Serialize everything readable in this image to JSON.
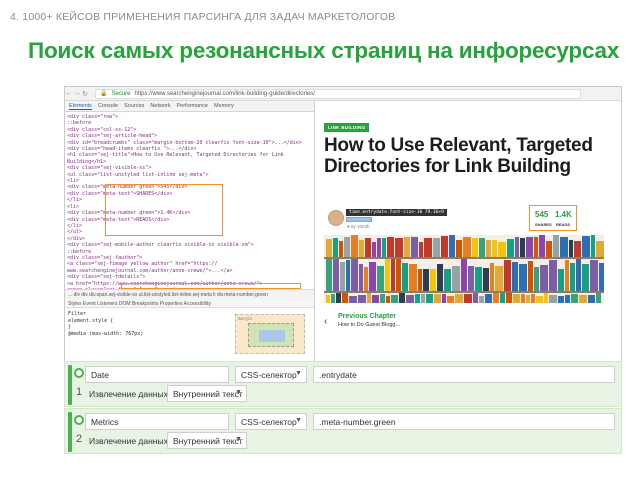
{
  "slide": {
    "kicker": "4. 1000+ КЕЙСОВ ПРИМЕНЕНИЯ ПАРСИНГА ДЛЯ ЗАДАЧ МАРКЕТОЛОГОВ",
    "headline": "Поиск самых резонансных страниц на инфоресурсах"
  },
  "browser": {
    "secure_label": "Secure",
    "url": "https://www.searchenginejournal.com/link-building-guide/directories/",
    "devtools_tabs": [
      "Elements",
      "Console",
      "Sources",
      "Network",
      "Performance",
      "Memory"
    ],
    "dom_lines": [
      "<div class=\"row\">",
      "  ::before",
      "  <div class=\"col-xs-12\">",
      "    <div class=\"sej-article-head\">",
      "      <div id=\"breadcrumbs\" class=\"margin-bottom-20 clearfix font-size-10\">...</div>",
      "      <div class=\"head-items clearfix \">...</div>",
      "      <h1 class=\"sej-title\">How to Use Relevant, Targeted Directories for Link",
      "      Building</h1>",
      "      <div class=\"sej-visible-xs\">",
      "        <ul class=\"list-unstyled list-inline sej-meta\">",
      "          <li>",
      "            <div class=\"meta-number green\">545</div>",
      "            <div class=\"meta-text\">SHARES</div>",
      "          </li>",
      "          <li>",
      "            <div class=\"meta-number green\">1.4K</div>",
      "            <div class=\"meta-text\">READS</div>",
      "          </li>",
      "        </ul>",
      "      </div>",
      "      <div class=\"sej-mobile-author clearfix visible-xs visible-sm\">",
      "        ::before",
      "        <div class=\"sej-fauthor\">",
      "          <a class=\"sej-fimage yellow author\" href=\"https://",
      "          www.searchenginejournal.com/author/anne-crewe/\">...</a>",
      "          <div class=\"sej-fdetails\">",
      "            <a href=\"https://www.searchenginejournal.com/author/anne-crewe/\">",
      "            <span class=\"sej-fname\">Anne Crewe</span>",
      "            <time class=\"entrydate font-size-10\">May 25, 2010</time>",
      "            <span class=\"meta-text\">...</span>"
    ],
    "breadcrumb_path": "... div   div   div.span.sej-visible-xs   ul.list-unstyled.list-inline.sej-meta   li   div.meta-number.green",
    "breadcrumb_active": "span.sej-visible-xs.visible-sm",
    "styles_tabs": "Styles   Event Listeners   DOM Breakpoints   Properties   Accessibility",
    "styles_lines": [
      "Filter",
      "element.style {",
      "}",
      "@media (max-width: 767px)"
    ],
    "box_model_label": "margin",
    "article": {
      "category": "LINK BUILDING",
      "title": "How to Use Relevant, Targeted Directories for Link Building",
      "tooltip": "time.entrydate.font-size-10  79.36×9",
      "author_note": "● 8y 10mth",
      "shares_value": "545",
      "shares_label": "SHARES",
      "reads_value": "1.4K",
      "reads_label": "READS",
      "prev_label": "Previous Chapter",
      "prev_sub": "How to Do Guest Blogg..."
    }
  },
  "rows": [
    {
      "number": "1",
      "name": "Date",
      "selector_type": "CSS-селектор",
      "selector": ".entrydate",
      "extract_label": "Извлечение данных:",
      "extract_value": "Внутренний текст"
    },
    {
      "number": "2",
      "name": "Metrics",
      "selector_type": "CSS-селектор",
      "selector": ".meta-number.green",
      "extract_label": "Извлечение данных:",
      "extract_value": "Внутренний текст"
    }
  ],
  "colors": {
    "accent_green": "#24a43a",
    "highlight_orange": "#f0932b"
  },
  "icons": {
    "caret": "▼",
    "back_arrow": "‹"
  }
}
